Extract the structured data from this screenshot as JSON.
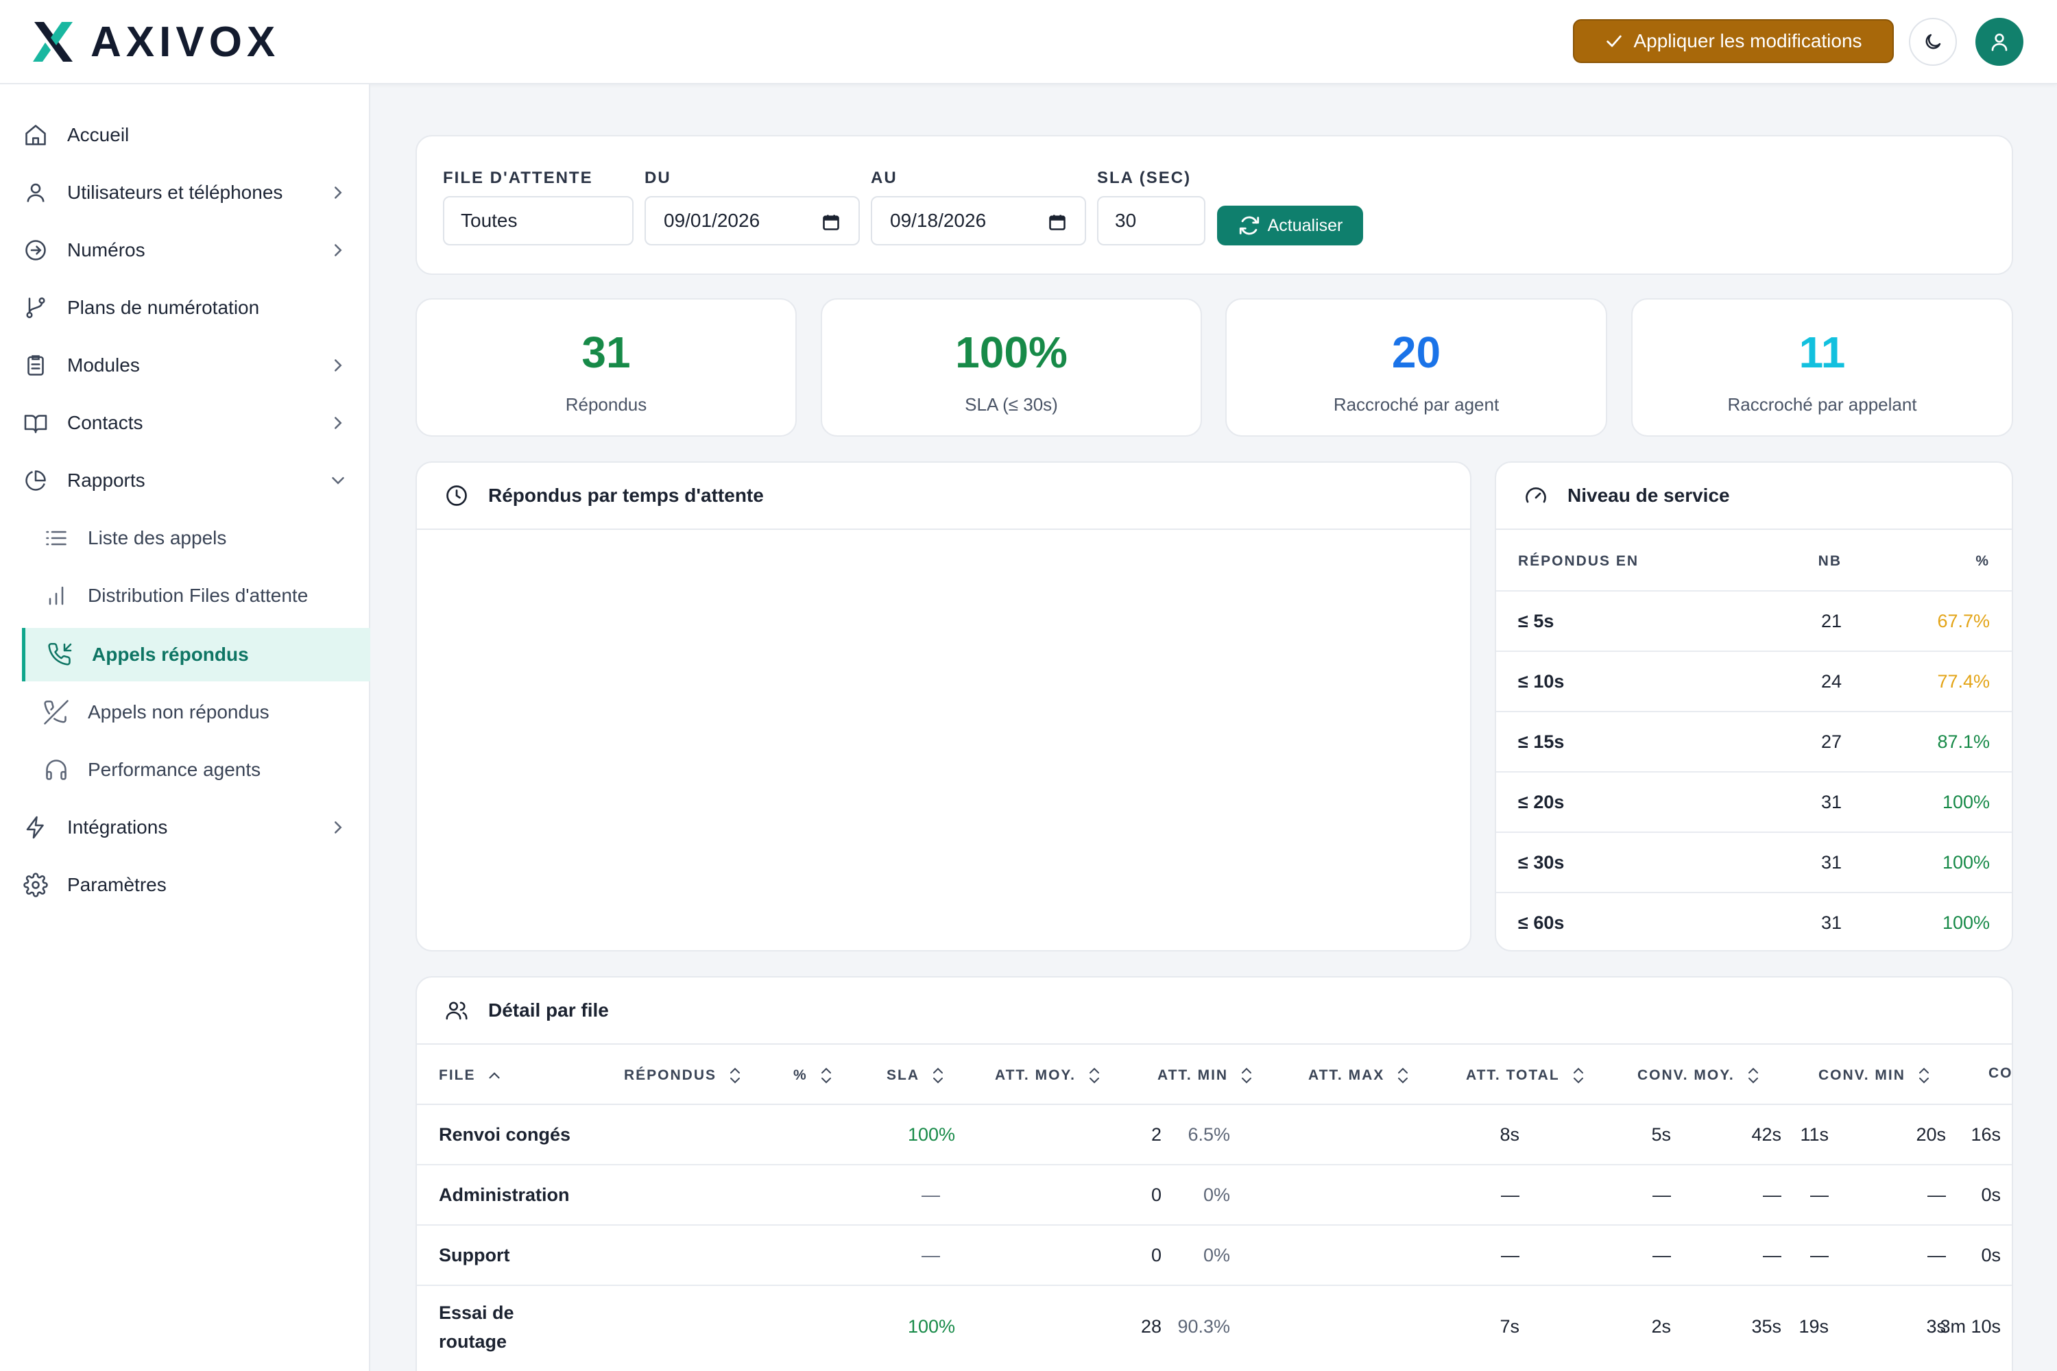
{
  "app": {
    "brand": "AXIVOX",
    "apply_label": "Appliquer les modifications"
  },
  "icons": {
    "apply": "check-icon",
    "theme": "moon-icon",
    "account": "user-icon"
  },
  "colors": {
    "primary": "#0f7f6d",
    "accent_apply": "#a8680a",
    "answered": "#178a48",
    "agent_hangup": "#1a73e8",
    "caller_hangup": "#12c0de",
    "warning": "#e3a417"
  },
  "sidebar": {
    "items": [
      {
        "label": "Accueil",
        "icon": "home-icon"
      },
      {
        "label": "Utilisateurs et téléphones",
        "icon": "user-icon"
      },
      {
        "label": "Numéros",
        "icon": "arrow-circle-icon"
      },
      {
        "label": "Plans de numérotation",
        "icon": "git-branch-icon"
      },
      {
        "label": "Modules",
        "icon": "clipboard-icon"
      },
      {
        "label": "Contacts",
        "icon": "book-icon"
      },
      {
        "label": "Rapports",
        "icon": "pie-chart-icon"
      },
      {
        "label": "Liste des appels",
        "icon": "list-icon"
      },
      {
        "label": "Distribution Files d'attente",
        "icon": "bar-chart-icon"
      },
      {
        "label": "Appels répondus",
        "icon": "phone-incoming-icon"
      },
      {
        "label": "Appels non répondus",
        "icon": "phone-missed-icon"
      },
      {
        "label": "Performance agents",
        "icon": "headphones-icon"
      },
      {
        "label": "Intégrations",
        "icon": "zap-icon"
      },
      {
        "label": "Paramètres",
        "icon": "gear-icon"
      }
    ]
  },
  "filters": {
    "queue_label": "FILE D'ATTENTE",
    "queue_value": "Toutes",
    "from_label": "DU",
    "from_value": "09/01/2026",
    "to_label": "AU",
    "to_value": "09/18/2026",
    "sla_label": "SLA (SEC)",
    "sla_value": "30",
    "refresh_label": "Actualiser"
  },
  "stats": [
    {
      "value": "31",
      "label": "Répondus"
    },
    {
      "value": "100%",
      "label": "SLA (≤ 30s)"
    },
    {
      "value": "20",
      "label": "Raccroché par agent"
    },
    {
      "value": "11",
      "label": "Raccroché par appelant"
    }
  ],
  "wait_chart": {
    "title": "Répondus par temps d'attente"
  },
  "service_level": {
    "title": "Niveau de service",
    "headers": [
      "RÉPONDUS EN",
      "NB",
      "%"
    ],
    "rows": [
      {
        "threshold": "≤ 5s",
        "count": "21",
        "pct": "67.7%"
      },
      {
        "threshold": "≤ 10s",
        "count": "24",
        "pct": "77.4%"
      },
      {
        "threshold": "≤ 15s",
        "count": "27",
        "pct": "87.1%"
      },
      {
        "threshold": "≤ 20s",
        "count": "31",
        "pct": "100%"
      },
      {
        "threshold": "≤ 30s",
        "count": "31",
        "pct": "100%"
      },
      {
        "threshold": "≤ 60s",
        "count": "31",
        "pct": "100%"
      }
    ]
  },
  "detail": {
    "title": "Détail par file",
    "headers": [
      "FILE",
      "RÉPONDUS",
      "%",
      "SLA",
      "ATT. MOY.",
      "ATT. MIN",
      "ATT. MAX",
      "ATT. TOTAL",
      "CONV. MOY.",
      "CONV. MIN",
      "CO"
    ],
    "rows": [
      {
        "name": "Renvoi congés",
        "answered": "2",
        "pct": "6.5%",
        "sla": "100%",
        "avg_wait": "8s",
        "min_wait": "5s",
        "max_wait": "11s",
        "total_wait": "16s",
        "avg_conv": "42s",
        "min_conv": "20s"
      },
      {
        "name": "Administration",
        "answered": "0",
        "pct": "0%",
        "sla": "—",
        "avg_wait": "—",
        "min_wait": "—",
        "max_wait": "—",
        "total_wait": "0s",
        "avg_conv": "—",
        "min_conv": "—"
      },
      {
        "name": "Support",
        "answered": "0",
        "pct": "0%",
        "sla": "—",
        "avg_wait": "—",
        "min_wait": "—",
        "max_wait": "—",
        "total_wait": "0s",
        "avg_conv": "—",
        "min_conv": "—"
      },
      {
        "name": "Essai de routage",
        "answered": "28",
        "pct": "90.3%",
        "sla": "100%",
        "avg_wait": "7s",
        "min_wait": "2s",
        "max_wait": "19s",
        "total_wait": "3m 10s",
        "avg_conv": "35s",
        "min_conv": "3s"
      }
    ]
  }
}
